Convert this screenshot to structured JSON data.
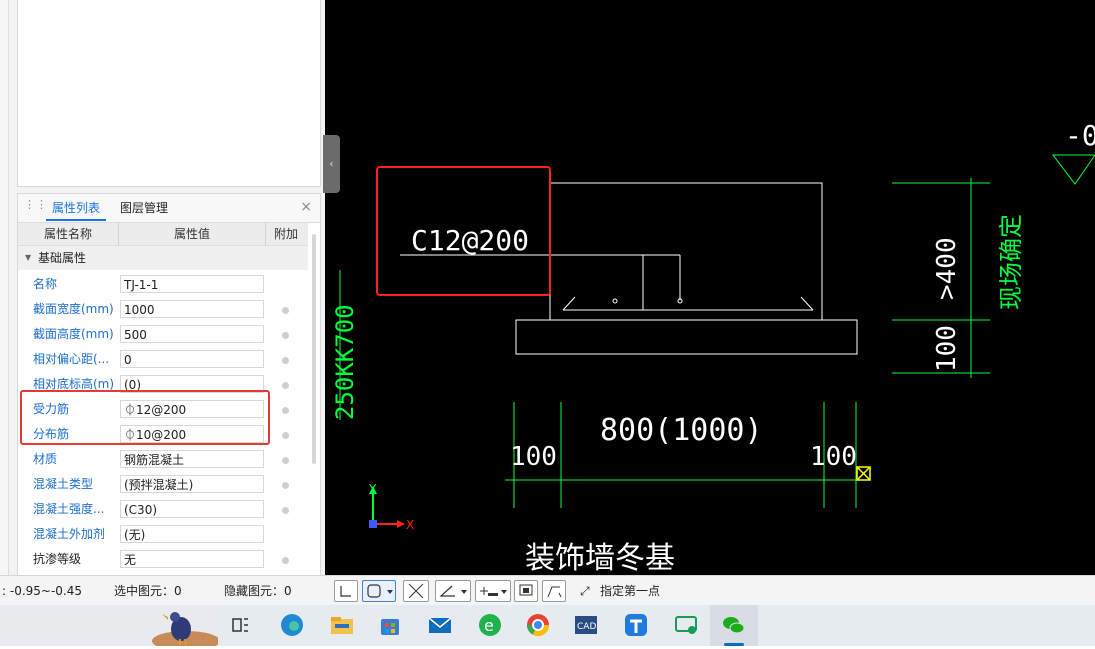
{
  "panel": {
    "tabs": [
      "属性列表",
      "图层管理"
    ],
    "close": "×",
    "headers": [
      "属性名称",
      "属性值",
      "附加"
    ],
    "group_label": "基础属性",
    "rows": [
      {
        "name": "名称",
        "value": "TJ-1-1"
      },
      {
        "name": "截面宽度(mm)",
        "value": "1000"
      },
      {
        "name": "截面高度(mm)",
        "value": "500"
      },
      {
        "name": "相对偏心距(...",
        "value": "0"
      },
      {
        "name": "相对底标高(m)",
        "value": "(0)"
      },
      {
        "name": "受力筋",
        "value": "⏀12@200"
      },
      {
        "name": "分布筋",
        "value": "⏀10@200"
      },
      {
        "name": "材质",
        "value": "钢筋混凝土"
      },
      {
        "name": "混凝土类型",
        "value": "(预拌混凝土)"
      },
      {
        "name": "混凝土强度...",
        "value": "(C30)"
      },
      {
        "name": "混凝土外加剂",
        "value": "(无)"
      },
      {
        "name": "抗渗等级",
        "value": "无"
      }
    ]
  },
  "cad": {
    "rebar_label": "C12@200",
    "width_label": "800(1000)",
    "left_dim": "100",
    "right_dim": "100",
    "height_dim_top": ">400",
    "height_dim_bottom": "100",
    "side_text": "现场确定",
    "vertical_text": "250KK700",
    "bottom_text": "装饰墙冬基",
    "level_text": "-0",
    "axis_y": "Y",
    "axis_x": "X",
    "colors": {
      "white": "#ffffff",
      "green": "#00ff3c",
      "yellow": "#ffff00",
      "red": "#ff2020",
      "blue": "#3b5bff"
    }
  },
  "status": {
    "range": ": -0.95~-0.45",
    "selected": "选中图元：0",
    "hidden": "隐藏图元：0",
    "hint": "指定第一点"
  }
}
